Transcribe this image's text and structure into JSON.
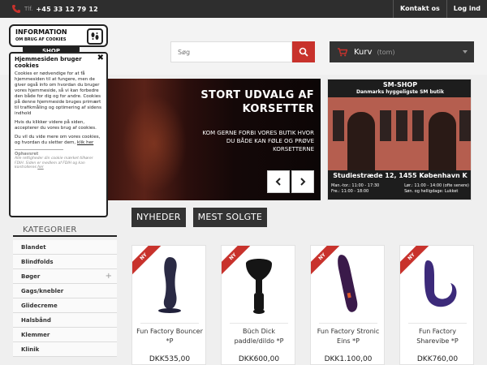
{
  "topbar": {
    "tlf_label": "Tlf.",
    "phone": "+45 33 12 79 12",
    "links": [
      "Kontakt os",
      "Log ind"
    ]
  },
  "search": {
    "placeholder": "Søg"
  },
  "cart": {
    "label": "Kurv",
    "count": "(tom)"
  },
  "logo": {
    "tab": "SHOP"
  },
  "banner": {
    "title": "STORT UDVALG AF KORSETTER",
    "subtitle": "KOM GERNE FORBI VORES BUTIK HVOR DU BÅDE KAN FØLE OG PRØVE KORSETTERNE"
  },
  "shop_panel": {
    "title": "SM-SHOP",
    "tagline": "Danmarks hyggeligste SM butik",
    "address": "Studiestræde 12, 1455 København K",
    "hours_left": [
      "Man.-tor.: 11:00 - 17:30",
      "Fre.: 11:00 - 18:00"
    ],
    "hours_right": [
      "Lør.: 11:00 - 14:00 (ofte senere)",
      "Søn. og helligdage: Lukket"
    ]
  },
  "tabs": [
    "NYHEDER",
    "MEST SOLGTE"
  ],
  "sidebar": {
    "title": "KATEGORIER",
    "items": [
      "Blandet",
      "Blindfolds",
      "Bøger",
      "Gags/knebler",
      "Glidecreme",
      "Halsbånd",
      "Klemmer",
      "Klinik"
    ],
    "expandable_index": 2
  },
  "products": [
    {
      "badge": "NY",
      "name": "Fun Factory Bouncer *P",
      "price": "DKK535,00",
      "color": "#2a2a44"
    },
    {
      "badge": "NY",
      "name": "Büch Dick paddle/dildo *P",
      "price": "DKK600,00",
      "color": "#151515"
    },
    {
      "badge": "NY",
      "name": "Fun Factory Stronic Eins *P",
      "price": "DKK1.100,00",
      "color": "#3a1a4a"
    },
    {
      "badge": "NY",
      "name": "Fun Factory Sharevibe *P",
      "price": "DKK760,00",
      "color": "#3c2a7a"
    }
  ],
  "cookie": {
    "header_title": "INFORMATION",
    "header_sub": "OM BRUG AF COOKIES",
    "title": "Hjemmesiden bruger cookies",
    "p1": "Cookies er nødvendige for at få hjemmesiden til at fungere, men de giver også info om hvordan du bruger vores hjemmeside, så vi kan forbedre den både for dig og for andre. Cookies på denne hjemmeside bruges primært til trafikmåling og optimering af sidens indhold",
    "p2": "Hvis du klikker videre på siden, accepterer du vores brug af cookies.",
    "p3_pre": "Du vil du vide mere om vores cookies, og hvordan du sletter dem,",
    "p3_link": "klik her",
    "foot_title": "Ophavsret",
    "foot_pre": "Alle rettigheder din cookie mærket tilhører FDIH. Siden er medlem af FDIH og kan kontrolleres",
    "foot_link": "her"
  },
  "colors": {
    "accent": "#c8322c",
    "dark": "#333333",
    "topbar": "#2e2e2e"
  }
}
